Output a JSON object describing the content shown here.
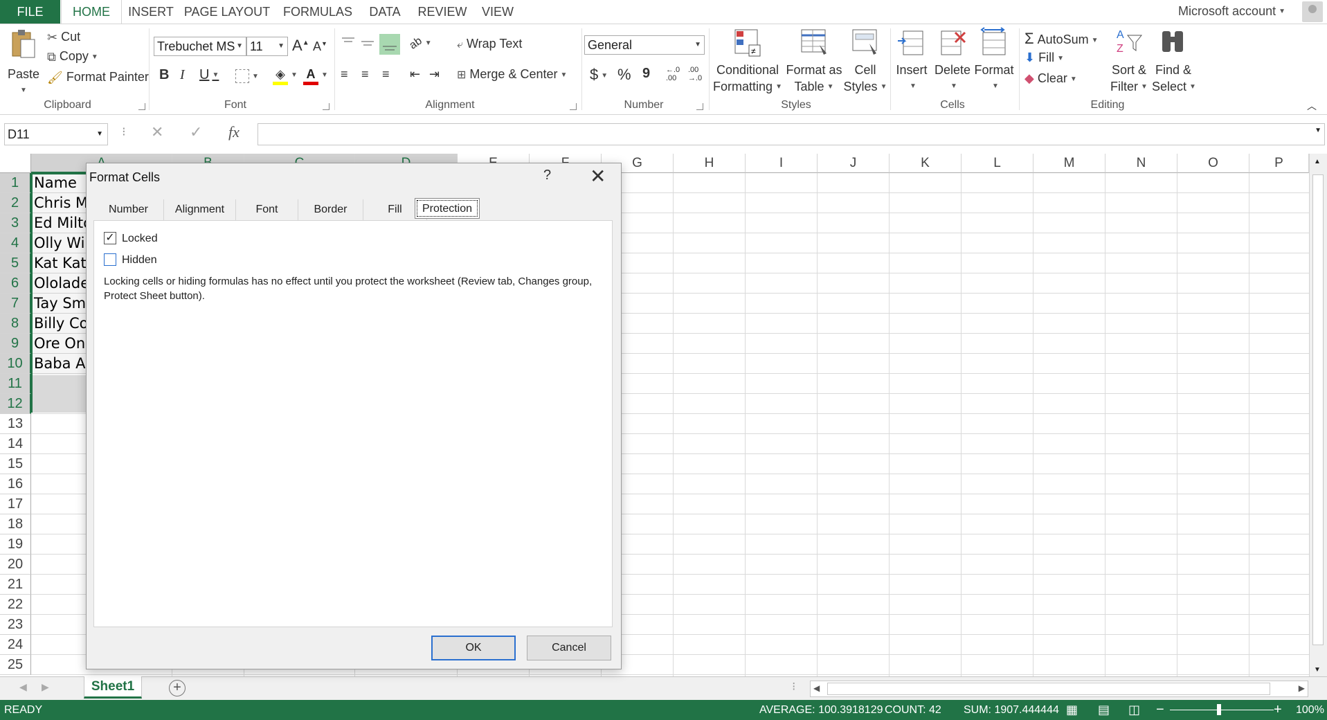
{
  "ribbon_tabs": [
    "FILE",
    "HOME",
    "INSERT",
    "PAGE LAYOUT",
    "FORMULAS",
    "DATA",
    "REVIEW",
    "VIEW"
  ],
  "account": "Microsoft account",
  "clipboard": {
    "paste": "Paste",
    "cut": "Cut",
    "copy": "Copy",
    "format_painter": "Format Painter",
    "label": "Clipboard"
  },
  "font": {
    "name": "Trebuchet MS",
    "size": "11",
    "bold": "B",
    "italic": "I",
    "underline": "U",
    "label": "Font"
  },
  "alignment": {
    "wrap_text": "Wrap Text",
    "merge_center": "Merge & Center",
    "label": "Alignment"
  },
  "number": {
    "format": "General",
    "currency": "$",
    "percent": "%",
    "comma": "9",
    "label": "Number"
  },
  "styles": {
    "conditional_1": "Conditional",
    "conditional_2": "Formatting",
    "format_table_1": "Format as",
    "format_table_2": "Table",
    "cell_styles_1": "Cell",
    "cell_styles_2": "Styles",
    "label": "Styles"
  },
  "cells": {
    "insert": "Insert",
    "delete": "Delete",
    "format": "Format",
    "label": "Cells"
  },
  "editing": {
    "autosum": "AutoSum",
    "fill": "Fill",
    "clear": "Clear",
    "sort_1": "Sort &",
    "sort_2": "Filter",
    "find_1": "Find &",
    "find_2": "Select",
    "label": "Editing"
  },
  "formula_bar": {
    "name_box": "D11",
    "fx": "fx",
    "value": ""
  },
  "columns": [
    "A",
    "B",
    "C",
    "D",
    "E",
    "F",
    "G",
    "H",
    "I",
    "J",
    "K",
    "L",
    "M",
    "N",
    "O",
    "P"
  ],
  "rows": [
    "1",
    "2",
    "3",
    "4",
    "5",
    "6",
    "7",
    "8",
    "9",
    "10",
    "11",
    "12",
    "13",
    "14",
    "15",
    "16",
    "17",
    "18",
    "19",
    "20",
    "21",
    "22",
    "23",
    "24",
    "25"
  ],
  "cells_a": [
    "Name",
    "Chris Mo",
    "Ed Milto",
    "Olly Wil",
    "Kat Kat",
    "Ololade",
    "Tay Smi",
    "Billy Col",
    "Ore Oni",
    "Baba Al"
  ],
  "sheet": {
    "tab": "Sheet1",
    "add": "+"
  },
  "status": {
    "mode": "READY",
    "average": "AVERAGE: 100.3918129",
    "count": "COUNT: 42",
    "sum": "SUM: 1907.444444",
    "zoom": "100%"
  },
  "dialog": {
    "title": "Format Cells",
    "help": "?",
    "tabs": [
      "Number",
      "Alignment",
      "Font",
      "Border",
      "Fill",
      "Protection"
    ],
    "locked_label": "Locked",
    "locked_checked": true,
    "hidden_label": "Hidden",
    "hidden_checked": false,
    "note": "Locking cells or hiding formulas has no effect until you protect the worksheet (Review tab, Changes group, Protect Sheet button).",
    "ok": "OK",
    "cancel": "Cancel"
  }
}
